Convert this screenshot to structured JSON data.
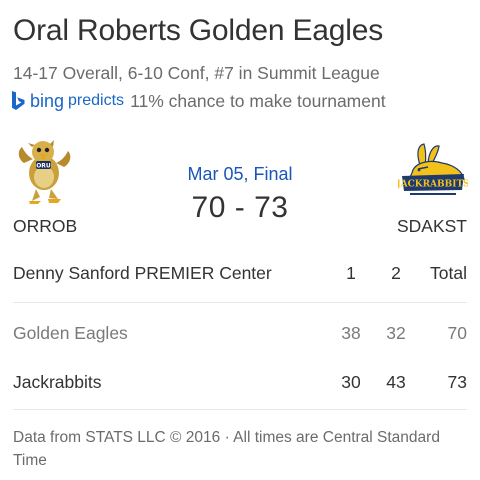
{
  "header": {
    "title": "Oral Roberts Golden Eagles",
    "subtitle": "14-17 Overall, 6-10 Conf, #7 in Summit League",
    "bing": {
      "logo_icon": "bing-logo-icon",
      "word": "bing",
      "predicts": "predicts",
      "text": "11% chance to make tournament"
    }
  },
  "game": {
    "date": "Mar 05, Final",
    "score": "70 - 73",
    "home": {
      "abbr": "ORROB",
      "logo_icon": "golden-eagle-mascot-icon"
    },
    "away": {
      "abbr": "SDAKST",
      "logo_icon": "jackrabbits-logo-icon",
      "logo_text": "JACKRABBITS"
    }
  },
  "table": {
    "venue": "Denny Sanford PREMIER Center",
    "col1": "1",
    "col2": "2",
    "total": "Total",
    "rows": [
      {
        "name": "Golden Eagles",
        "p1": "38",
        "p2": "32",
        "total": "70"
      },
      {
        "name": "Jackrabbits",
        "p1": "30",
        "p2": "43",
        "total": "73"
      }
    ]
  },
  "footer": {
    "text": "Data from STATS LLC © 2016 · All times are Central Standard Time"
  },
  "colors": {
    "accent_blue": "#1a55b8",
    "bing_blue": "#1a66c9",
    "muted_text": "#6b6b6b",
    "divider": "#e6e6e6"
  }
}
